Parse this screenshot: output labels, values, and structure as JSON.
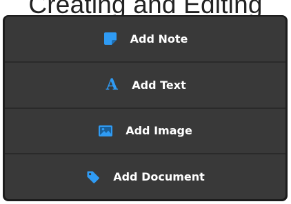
{
  "heading": "Creating and Editing",
  "colors": {
    "accent": "#2f9bf4",
    "menu_bg": "#393939",
    "menu_border": "#1c1c1c",
    "text": "#ffffff"
  },
  "menu": {
    "items": [
      {
        "label": "Add Note",
        "icon": "sticky-note-icon"
      },
      {
        "label": "Add Text",
        "icon": "letter-a-icon",
        "glyph": "A"
      },
      {
        "label": "Add Image",
        "icon": "image-icon"
      },
      {
        "label": "Add Document",
        "icon": "tag-icon"
      }
    ]
  }
}
